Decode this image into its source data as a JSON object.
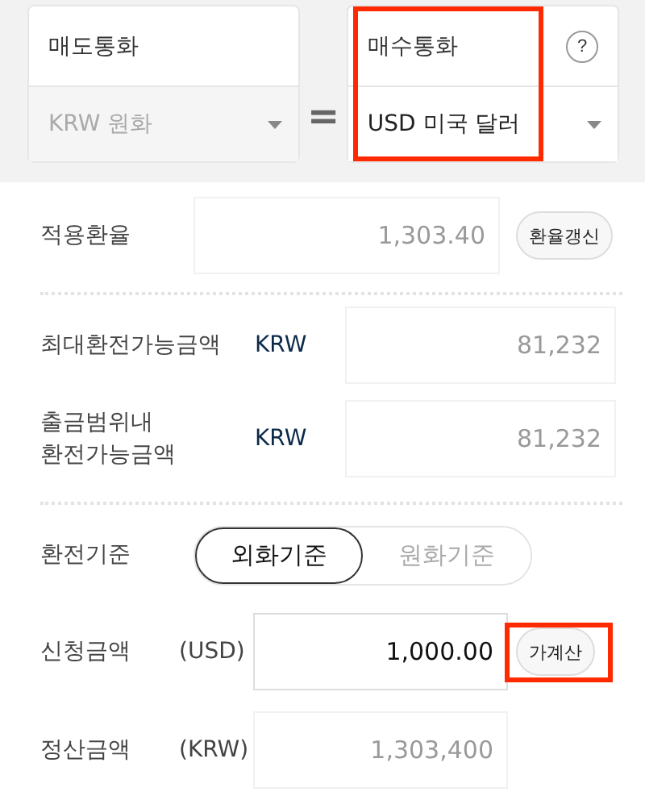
{
  "sell_currency": {
    "label": "매도통화",
    "value": "KRW 원화",
    "disabled": true
  },
  "equals": "=",
  "buy_currency": {
    "label": "매수통화",
    "value": "USD 미국 달러",
    "disabled": false,
    "highlighted": true,
    "help": "?"
  },
  "applied_rate": {
    "label": "적용환율",
    "value": "1,303.40",
    "button": "환율갱신"
  },
  "limits": [
    {
      "label": "최대환전가능금액",
      "currency": "KRW",
      "value": "81,232"
    },
    {
      "label": "출금범위내\n환전가능금액",
      "currency": "KRW",
      "value": "81,232"
    }
  ],
  "exchange_basis": {
    "label": "환전기준",
    "options": [
      {
        "label": "외화기준",
        "selected": true
      },
      {
        "label": "원화기준",
        "selected": false
      }
    ]
  },
  "request_amount": {
    "label": "신청금액",
    "currency": "(USD)",
    "value": "1,000.00",
    "button": "가계산",
    "highlighted": true
  },
  "settlement_amount": {
    "label": "정산금액",
    "currency": "(KRW)",
    "value": "1,303,400"
  }
}
